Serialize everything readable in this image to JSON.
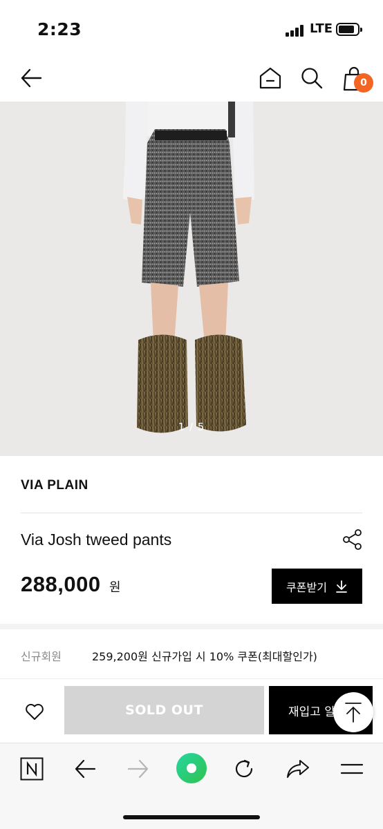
{
  "status_bar": {
    "time": "2:23",
    "network": "LTE"
  },
  "top_nav": {
    "icons": [
      "back-arrow-icon",
      "home-icon",
      "search-icon",
      "shopping-bag-icon"
    ],
    "cart_count": "0",
    "accent_color": "#f26522"
  },
  "gallery": {
    "counter": "1 / 5"
  },
  "product": {
    "brand": "VIA PLAIN",
    "name": "Via Josh tweed pants",
    "price": "288,000",
    "price_unit": "원",
    "coupon_button": "쿠폰받기"
  },
  "benefit": {
    "label": "신규회원",
    "text": "259,200원 신규가입 시 10% 쿠폰(최대할인가)"
  },
  "actions": {
    "soldout_label": "SOLD OUT",
    "restock_label": "재입고 알림"
  },
  "browser_toolbar": {
    "icons": [
      "naver-n-icon",
      "back-icon",
      "forward-icon",
      "green-dot-icon",
      "refresh-icon",
      "share-icon",
      "menu-icon"
    ]
  }
}
